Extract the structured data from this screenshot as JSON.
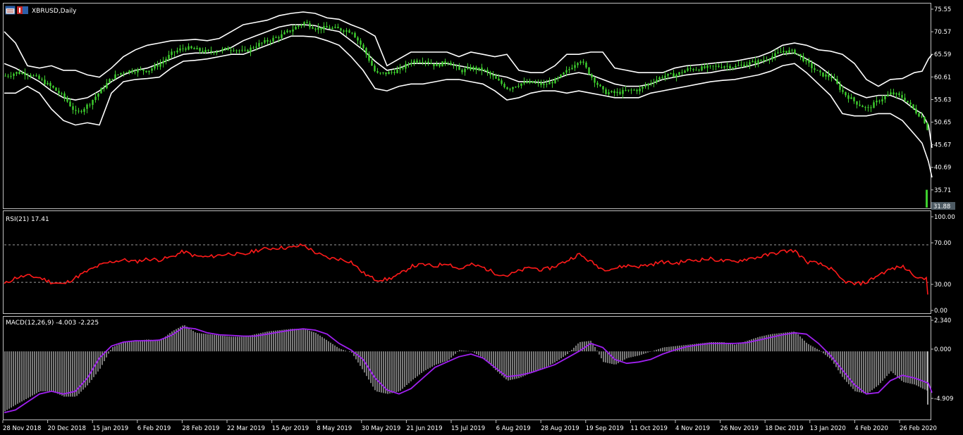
{
  "window": {
    "symbol_title": "XBRUSD,Daily",
    "icons": [
      "chart-window-icon",
      "flag-icon"
    ]
  },
  "colors": {
    "background": "#000000",
    "candle": "#3ecf2e",
    "bands": "#ffffff",
    "rsi": "#ff1a1a",
    "macd_signal": "#a020f0",
    "macd_hist": "#c8c8c8",
    "frame": "#c0c0c0",
    "last_price_bg": "#4d5a63"
  },
  "price_panel": {
    "yticks": [
      "75.55",
      "70.57",
      "65.59",
      "60.61",
      "55.63",
      "50.65",
      "45.67",
      "40.69",
      "35.71"
    ],
    "last_price": "31.88"
  },
  "rsi_panel": {
    "title": "RSI(21) 17.41",
    "yticks": [
      "100.00",
      "70.00",
      "30.00",
      "0.00"
    ]
  },
  "macd_panel": {
    "title": "MACD(12,26,9) -4.003 -2.225",
    "yticks": [
      "2.340",
      "0.000",
      "-4.909"
    ]
  },
  "time_axis": {
    "labels": [
      "28 Nov 2018",
      "20 Dec 2018",
      "15 Jan 2019",
      "6 Feb 2019",
      "28 Feb 2019",
      "22 Mar 2019",
      "15 Apr 2019",
      "8 May 2019",
      "30 May 2019",
      "21 Jun 2019",
      "15 Jul 2019",
      "6 Aug 2019",
      "28 Aug 2019",
      "19 Sep 2019",
      "11 Oct 2019",
      "4 Nov 2019",
      "26 Nov 2019",
      "18 Dec 2019",
      "13 Jan 2020",
      "4 Feb 2020",
      "26 Feb 2020"
    ]
  },
  "chart_data": [
    {
      "type": "line",
      "title": "XBRUSD,Daily",
      "x_index": [
        0,
        16,
        33,
        50,
        67,
        84,
        101,
        118,
        135,
        152,
        169,
        186,
        203,
        220,
        237,
        254,
        271,
        288,
        305,
        322,
        339,
        356,
        373,
        390,
        407,
        424,
        441,
        458,
        475,
        492,
        509,
        526,
        543,
        560,
        577,
        594,
        611,
        628,
        645,
        662,
        679,
        696,
        713,
        730,
        747,
        764,
        781,
        798,
        815,
        832,
        849,
        866,
        883,
        900,
        917,
        934,
        951,
        968,
        985,
        1002,
        1019,
        1036,
        1053,
        1070,
        1087,
        1104,
        1121,
        1138,
        1155,
        1172,
        1189,
        1206,
        1223,
        1240,
        1257,
        1274,
        1291,
        1302,
        1311,
        1316
      ],
      "ylim": [
        31.88,
        76.5
      ],
      "series": [
        {
          "name": "close",
          "values": [
            60.8,
            61.5,
            61.3,
            59.9,
            58.2,
            56.0,
            52.5,
            54.5,
            57.5,
            60.5,
            61.8,
            62.0,
            62.0,
            63.5,
            65.8,
            67.0,
            66.5,
            66.0,
            66.4,
            66.8,
            66.0,
            67.5,
            68.5,
            69.5,
            71.0,
            72.5,
            71.2,
            71.3,
            71.0,
            70.5,
            66.5,
            61.2,
            61.4,
            62.2,
            64.0,
            64.3,
            63.0,
            64.0,
            61.8,
            62.5,
            62.0,
            60.0,
            58.0,
            59.1,
            59.3,
            58.8,
            59.8,
            62.0,
            64.5,
            60.5,
            57.2,
            57.0,
            57.5,
            57.8,
            59.5,
            60.8,
            61.0,
            62.2,
            62.4,
            62.7,
            63.0,
            62.8,
            63.5,
            64.0,
            65.0,
            66.3,
            66.0,
            63.5,
            61.2,
            60.5,
            57.0,
            55.0,
            53.5,
            55.5,
            57.0,
            56.0,
            53.0,
            51.5,
            48.0,
            33.0
          ]
        },
        {
          "name": "upper band",
          "values": [
            70.5,
            68.0,
            63.0,
            62.5,
            63.0,
            62.0,
            62.0,
            61.0,
            60.5,
            62.5,
            65.0,
            66.5,
            67.5,
            68.0,
            68.5,
            68.6,
            68.8,
            68.5,
            69.0,
            70.5,
            72.0,
            72.5,
            73.0,
            74.0,
            74.5,
            74.8,
            74.5,
            73.5,
            73.2,
            72.0,
            71.0,
            69.5,
            63.0,
            64.5,
            66.0,
            66.0,
            66.0,
            66.0,
            65.0,
            66.0,
            65.5,
            65.0,
            65.5,
            62.0,
            61.5,
            61.5,
            63.0,
            65.5,
            65.5,
            66.0,
            66.0,
            62.5,
            62.0,
            61.5,
            61.5,
            61.5,
            62.5,
            63.0,
            63.2,
            63.5,
            63.8,
            64.0,
            64.5,
            65.0,
            66.0,
            67.5,
            68.0,
            67.5,
            66.5,
            66.2,
            65.5,
            63.5,
            60.0,
            58.5,
            60.0,
            60.2,
            61.5,
            61.8,
            64.5,
            65.5
          ]
        },
        {
          "name": "middle band",
          "values": [
            63.5,
            62.5,
            61.0,
            59.5,
            57.5,
            56.0,
            55.5,
            56.0,
            57.5,
            59.5,
            61.0,
            62.0,
            62.5,
            63.5,
            64.5,
            65.5,
            65.8,
            65.8,
            66.2,
            67.0,
            68.5,
            69.5,
            70.5,
            71.5,
            72.0,
            72.0,
            71.8,
            71.0,
            70.5,
            68.5,
            66.5,
            64.0,
            62.0,
            62.5,
            63.5,
            63.5,
            63.5,
            63.5,
            63.0,
            62.5,
            62.0,
            61.0,
            60.5,
            59.5,
            59.5,
            59.3,
            60.0,
            61.0,
            61.5,
            61.0,
            60.0,
            59.0,
            58.5,
            58.5,
            59.0,
            60.0,
            60.5,
            61.0,
            61.3,
            61.5,
            62.0,
            62.3,
            62.8,
            63.5,
            64.5,
            65.5,
            65.8,
            64.5,
            63.0,
            61.0,
            58.5,
            57.0,
            56.0,
            56.5,
            56.5,
            55.5,
            53.5,
            52.5,
            50.0,
            45.0
          ]
        },
        {
          "name": "lower band",
          "values": [
            57.0,
            57.0,
            58.5,
            57.0,
            53.5,
            51.0,
            50.0,
            50.5,
            50.0,
            57.0,
            59.5,
            60.0,
            60.2,
            60.5,
            62.5,
            64.0,
            64.2,
            64.5,
            65.0,
            65.5,
            65.5,
            66.5,
            67.5,
            68.5,
            69.5,
            69.5,
            69.3,
            68.5,
            67.5,
            65.0,
            62.0,
            58.0,
            57.5,
            58.5,
            59.0,
            59.0,
            59.5,
            60.0,
            60.0,
            59.5,
            59.0,
            57.5,
            55.5,
            56.0,
            57.0,
            57.5,
            57.5,
            57.0,
            57.5,
            57.0,
            56.5,
            56.0,
            56.0,
            56.0,
            57.0,
            57.5,
            58.0,
            58.5,
            59.0,
            59.5,
            59.8,
            60.0,
            60.5,
            61.0,
            61.8,
            63.0,
            63.5,
            61.5,
            59.0,
            56.5,
            52.5,
            52.0,
            52.0,
            52.5,
            52.5,
            51.0,
            48.0,
            46.0,
            42.0,
            38.5
          ]
        }
      ]
    },
    {
      "type": "line",
      "title": "RSI(21) 17.41",
      "ylim": [
        0,
        100
      ],
      "levels": [
        70,
        30
      ],
      "x_index": [
        0,
        16,
        33,
        50,
        67,
        84,
        101,
        118,
        135,
        152,
        169,
        186,
        203,
        220,
        237,
        254,
        271,
        288,
        305,
        322,
        339,
        356,
        373,
        390,
        407,
        424,
        441,
        458,
        475,
        492,
        509,
        526,
        543,
        560,
        577,
        594,
        611,
        628,
        645,
        662,
        679,
        696,
        713,
        730,
        747,
        764,
        781,
        798,
        815,
        832,
        849,
        866,
        883,
        900,
        917,
        934,
        951,
        968,
        985,
        1002,
        1019,
        1036,
        1053,
        1070,
        1087,
        1104,
        1121,
        1138,
        1155,
        1172,
        1189,
        1206,
        1223,
        1240,
        1257,
        1274,
        1291,
        1302,
        1311,
        1316
      ],
      "series": [
        {
          "name": "RSI",
          "values": [
            28,
            35,
            37,
            35,
            30,
            28,
            35,
            42,
            48,
            52,
            54,
            52,
            55,
            54,
            57,
            63,
            58,
            57,
            59,
            61,
            59,
            64,
            66,
            67,
            67,
            70,
            62,
            56,
            55,
            52,
            40,
            33,
            33,
            38,
            47,
            49,
            47,
            51,
            44,
            49,
            46,
            40,
            37,
            42,
            46,
            43,
            47,
            53,
            60,
            52,
            44,
            45,
            48,
            47,
            49,
            52,
            50,
            53,
            54,
            55,
            53,
            52,
            55,
            57,
            60,
            63,
            64,
            52,
            50,
            45,
            32,
            28,
            30,
            38,
            44,
            47,
            38,
            33,
            35,
            17
          ]
        }
      ]
    },
    {
      "type": "bar",
      "title": "MACD(12,26,9) -4.003 -2.225",
      "ylim": [
        -4.909,
        2.34
      ],
      "x_index": [
        0,
        16,
        33,
        50,
        67,
        84,
        101,
        118,
        135,
        152,
        169,
        186,
        203,
        220,
        237,
        254,
        271,
        288,
        305,
        322,
        339,
        356,
        373,
        390,
        407,
        424,
        441,
        458,
        475,
        492,
        509,
        526,
        543,
        560,
        577,
        594,
        611,
        628,
        645,
        662,
        679,
        696,
        713,
        730,
        747,
        764,
        781,
        798,
        815,
        832,
        849,
        866,
        883,
        900,
        917,
        934,
        951,
        968,
        985,
        1002,
        1019,
        1036,
        1053,
        1070,
        1087,
        1104,
        1121,
        1138,
        1155,
        1172,
        1189,
        1206,
        1223,
        1240,
        1257,
        1274,
        1291,
        1302,
        1311,
        1316
      ],
      "series": [
        {
          "name": "MACD",
          "values": [
            -4.5,
            -4.0,
            -3.5,
            -3.0,
            -3.0,
            -3.4,
            -3.4,
            -2.5,
            -1.3,
            0.3,
            0.7,
            0.8,
            0.9,
            0.8,
            1.5,
            2.0,
            1.4,
            1.3,
            1.2,
            1.1,
            1.1,
            1.3,
            1.5,
            1.6,
            1.7,
            1.7,
            1.4,
            0.8,
            0.2,
            -0.1,
            -1.5,
            -3.0,
            -3.2,
            -3.0,
            -2.2,
            -1.5,
            -1.0,
            -0.7,
            0.1,
            0.0,
            -0.5,
            -1.4,
            -2.2,
            -2.0,
            -1.6,
            -1.3,
            -0.8,
            -0.2,
            0.7,
            0.8,
            -0.8,
            -1.0,
            -0.5,
            -0.3,
            0.0,
            0.3,
            0.4,
            0.5,
            0.6,
            0.7,
            0.7,
            0.5,
            0.8,
            1.1,
            1.3,
            1.4,
            1.5,
            0.6,
            0.1,
            -0.6,
            -2.0,
            -3.0,
            -3.2,
            -2.5,
            -1.5,
            -2.3,
            -2.5,
            -2.8,
            -3.0,
            -4.0
          ]
        },
        {
          "name": "Signal",
          "values": [
            -4.6,
            -4.4,
            -3.8,
            -3.2,
            -3.0,
            -3.2,
            -3.0,
            -2.0,
            -0.5,
            0.4,
            0.7,
            0.8,
            0.8,
            0.85,
            1.2,
            1.8,
            1.7,
            1.4,
            1.25,
            1.2,
            1.15,
            1.15,
            1.3,
            1.45,
            1.6,
            1.7,
            1.6,
            1.3,
            0.6,
            0.1,
            -0.6,
            -2.0,
            -2.9,
            -3.2,
            -2.8,
            -2.0,
            -1.2,
            -0.8,
            -0.4,
            -0.2,
            -0.5,
            -1.2,
            -1.9,
            -1.8,
            -1.6,
            -1.3,
            -1.0,
            -0.5,
            0.0,
            0.6,
            0.3,
            -0.6,
            -0.9,
            -0.8,
            -0.6,
            -0.2,
            0.1,
            0.35,
            0.5,
            0.6,
            0.6,
            0.6,
            0.65,
            0.85,
            1.05,
            1.25,
            1.4,
            1.3,
            0.6,
            -0.3,
            -1.4,
            -2.5,
            -3.2,
            -3.1,
            -2.2,
            -1.8,
            -2.0,
            -2.2,
            -2.4,
            -3.1
          ]
        }
      ]
    }
  ]
}
